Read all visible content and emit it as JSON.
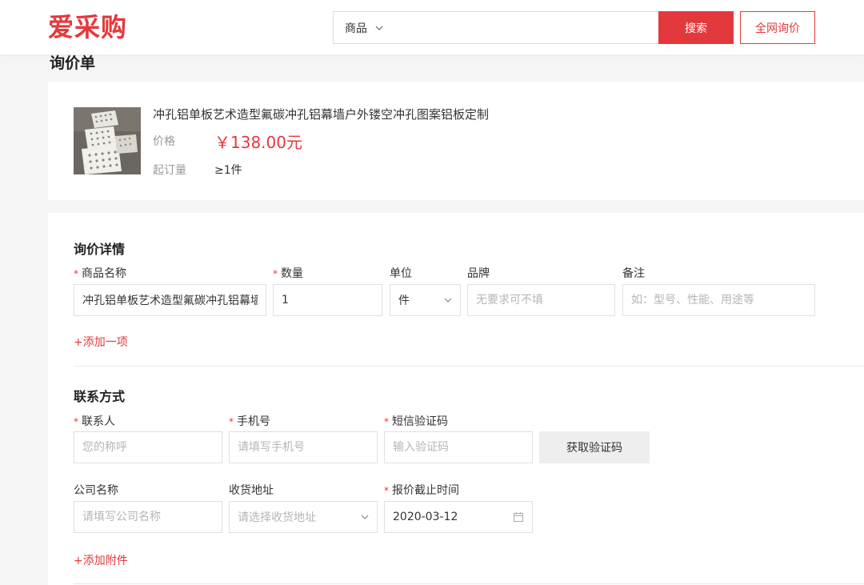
{
  "header": {
    "logo": "爱采购",
    "search_category": "商品",
    "search_placeholder": "",
    "search_button": "搜索",
    "inquiry_button": "全网询价"
  },
  "page_title": "询价单",
  "product": {
    "title": "冲孔铝单板艺术造型氟碳冲孔铝幕墙户外镂空冲孔图案铝板定制",
    "price_label": "价格",
    "price_value": "￥138.00元",
    "moq_label": "起订量",
    "moq_value": "≥1件"
  },
  "inquiry_details": {
    "title": "询价详情",
    "labels": {
      "product_name": "商品名称",
      "quantity": "数量",
      "unit": "单位",
      "brand": "品牌",
      "remark": "备注"
    },
    "values": {
      "product_name": "冲孔铝单板艺术造型氟碳冲孔铝幕墙",
      "quantity": "1",
      "unit": "件"
    },
    "placeholders": {
      "brand": "无要求可不填",
      "remark": "如：型号、性能、用途等"
    },
    "add_item": "+添加一项"
  },
  "contact": {
    "title": "联系方式",
    "labels": {
      "contact_person": "联系人",
      "phone": "手机号",
      "sms_code": "短信验证码",
      "company": "公司名称",
      "address": "收货地址",
      "deadline": "报价截止时间"
    },
    "placeholders": {
      "contact_person": "您的称呼",
      "phone": "请填写手机号",
      "sms_code": "输入验证码",
      "company": "请填写公司名称",
      "address": "请选择收货地址"
    },
    "deadline_value": "2020-03-12",
    "get_code_button": "获取验证码",
    "add_attachment": "+添加附件"
  },
  "colors": {
    "accent": "#e4393c",
    "background": "#f5f5f5"
  }
}
